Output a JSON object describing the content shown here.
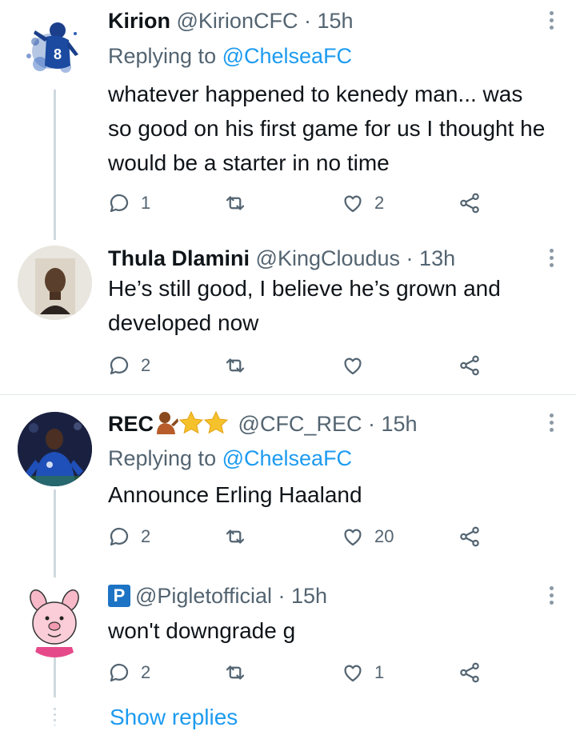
{
  "colors": {
    "link": "#1d9bf0",
    "muted": "#536471",
    "thread_line": "#cfd9de"
  },
  "tweets": [
    {
      "name": "Kirion",
      "meta": "@KirionCFC · 15h",
      "replying_prefix": "Replying to ",
      "replying_handle": "@ChelseaFC",
      "text": "whatever happened to kenedy man... was so good on his first game for us I thought he would be a starter in no time",
      "replies": "1",
      "retweets": "",
      "likes": "2",
      "avatar_icon": "chelsea-player-8-avatar"
    },
    {
      "name": "Thula Dlamini",
      "meta": "@KingCloudus · 13h",
      "text": "He’s still good, I believe he’s grown and developed now",
      "replies": "2",
      "retweets": "",
      "likes": "",
      "avatar_icon": "portrait-avatar"
    },
    {
      "name": "REC",
      "meta": "@CFC_REC · 15h",
      "replying_prefix": "Replying to ",
      "replying_handle": "@ChelseaFC",
      "text": "Announce Erling Haaland",
      "replies": "2",
      "retweets": "",
      "likes": "20",
      "avatar_icon": "footballer-avatar"
    },
    {
      "name": "",
      "badge": "P",
      "meta": "@Pigletofficial · 15h",
      "text": "won't downgrade g",
      "replies": "2",
      "retweets": "",
      "likes": "1",
      "avatar_icon": "piglet-avatar"
    }
  ],
  "show_replies": "Show replies"
}
